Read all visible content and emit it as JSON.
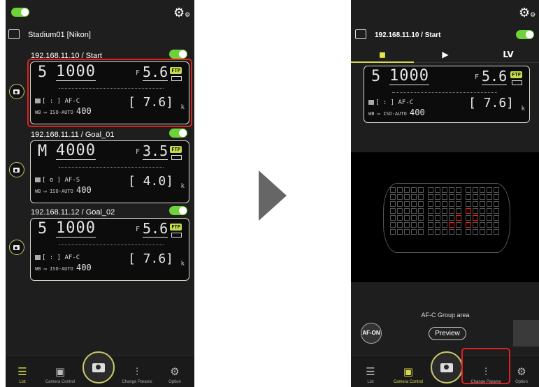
{
  "left": {
    "stadium": "Stadium01 [Nikon]",
    "cameras": [
      {
        "address": "192.168.11.10 / Start",
        "mode": "5",
        "shutter": "1000",
        "f_prefix": "F",
        "aperture": "5.6",
        "ftp": "FTP",
        "af": "[ : ] AF-C",
        "wb": "WB",
        "iso_label": "ISO-AUTO",
        "iso_value": "400",
        "remaining": "[   7.6]",
        "k": "k"
      },
      {
        "address": "192.168.11.11 / Goal_01",
        "mode": "M",
        "shutter": "4000",
        "f_prefix": "F",
        "aperture": "3.5",
        "ftp": "FTP",
        "af": "[ o ] AF-S",
        "wb": "WB",
        "iso_label": "ISO-AUTO",
        "iso_value": "400",
        "remaining": "[   4.0]",
        "k": "k"
      },
      {
        "address": "192.168.11.12 / Goal_02",
        "mode": "5",
        "shutter": "1000",
        "f_prefix": "F",
        "aperture": "5.6",
        "ftp": "FTP",
        "af": "[ : ] AF-C",
        "wb": "WB",
        "iso_label": "ISO-AUTO",
        "iso_value": "400",
        "remaining": "[   7.6]",
        "k": "k"
      }
    ],
    "tabs": [
      {
        "label": "List",
        "icon": "list-icon",
        "active": true
      },
      {
        "label": "Camera Control",
        "icon": "camera-control-icon",
        "active": false
      },
      {
        "label": "Change Params",
        "icon": "sliders-icon",
        "active": false
      },
      {
        "label": "Option",
        "icon": "gear-icon",
        "active": false
      }
    ]
  },
  "right": {
    "address": "192.168.11.10 / Start",
    "top_tabs": [
      {
        "label": "",
        "icon": "camera-icon"
      },
      {
        "label": "",
        "icon": "play-icon"
      },
      {
        "label": "LV",
        "icon": ""
      }
    ],
    "panel": {
      "mode": "5",
      "shutter": "1000",
      "f_prefix": "F",
      "aperture": "5.6",
      "ftp": "FTP",
      "af": "[ : ] AF-C",
      "wb": "WB",
      "iso_label": "ISO-AUTO",
      "iso_value": "400",
      "remaining": "[   7.6]",
      "k": "k"
    },
    "af_mode_text": "AF-C  Group area",
    "af_on": "AF-ON",
    "preview": "Preview",
    "tabs": [
      {
        "label": "List",
        "icon": "list-icon",
        "active": false
      },
      {
        "label": "Camera Control",
        "icon": "camera-control-icon",
        "active": true
      },
      {
        "label": "Change Params",
        "icon": "sliders-icon",
        "active": false
      },
      {
        "label": "Option",
        "icon": "gear-icon",
        "active": false
      }
    ]
  },
  "colors": {
    "accent": "#d8d84a",
    "toggle": "#6ed23a",
    "highlight": "#e02020"
  }
}
